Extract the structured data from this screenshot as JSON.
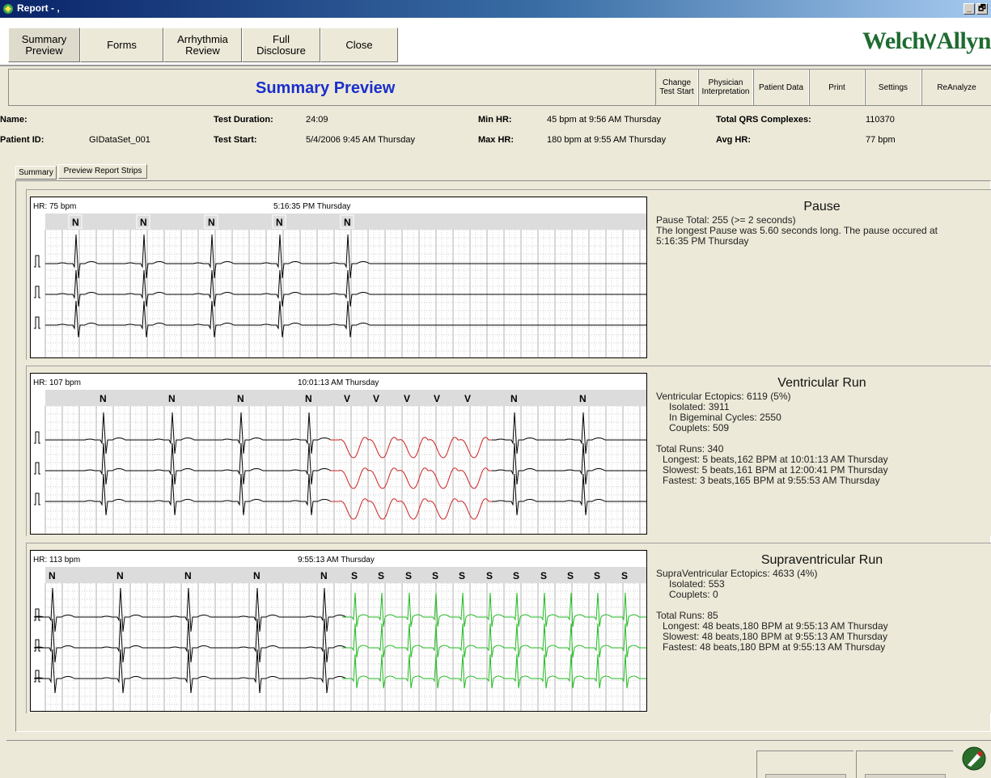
{
  "window": {
    "title": "Report - ,",
    "minimize": "_",
    "restore": "🗗"
  },
  "nav": [
    {
      "id": "summary",
      "label": "Summary\nPreview"
    },
    {
      "id": "forms",
      "label": "Forms"
    },
    {
      "id": "arrhythmia",
      "label": "Arrhythmia\nReview"
    },
    {
      "id": "full",
      "label": "Full\nDisclosure"
    },
    {
      "id": "close",
      "label": "Close"
    }
  ],
  "brand": {
    "left": "Welch",
    "right": "Allyn"
  },
  "header": {
    "title": "Summary Preview",
    "tools": [
      "Change\nTest Start",
      "Physician\nInterpretation",
      "Patient Data",
      "Print",
      "Settings",
      "ReAnalyze"
    ]
  },
  "patient": {
    "name_label": "Name:",
    "name_value": "",
    "id_label": "Patient ID:",
    "id_value": "GIDataSet_001",
    "duration_label": "Test Duration:",
    "duration_value": "24:09",
    "start_label": "Test Start:",
    "start_value": "5/4/2006 9:45 AM Thursday",
    "minhr_label": "Min HR:",
    "minhr_value": "45 bpm at 9:56 AM Thursday",
    "maxhr_label": "Max HR:",
    "maxhr_value": "180 bpm at 9:55 AM Thursday",
    "qrs_label": "Total QRS Complexes:",
    "qrs_value": "110370",
    "avghr_label": "Avg HR:",
    "avghr_value": "77 bpm"
  },
  "tabs": [
    "Summary",
    "Preview Report Strips"
  ],
  "colors": {
    "normal": "#000000",
    "ventricular": "#cc2222",
    "supraventricular": "#22bb22"
  },
  "panels": [
    {
      "hr": "HR: 75 bpm",
      "time": "5:16:35 PM Thursday",
      "beats": [
        "N",
        "N",
        "N",
        "N",
        "N"
      ],
      "title": "Pause",
      "lines": [
        "Pause Total: 255  (>= 2 seconds)",
        "The longest Pause was 5.60 seconds long. The pause occured at",
        "5:16:35 PM Thursday"
      ]
    },
    {
      "hr": "HR: 107 bpm",
      "time": "10:01:13 AM Thursday",
      "beats": [
        "N",
        "N",
        "N",
        "N",
        "V",
        "V",
        "V",
        "V",
        "V",
        "N",
        "N"
      ],
      "title": "Ventricular Run",
      "lines": [
        "Ventricular Ectopics: 6119 (5%)",
        "    Isolated: 3911",
        "    In Bigeminal Cycles: 2550",
        "    Couplets: 509",
        "",
        "Total Runs: 340",
        "   Longest: 5 beats,162 BPM at 10:01:13 AM Thursday",
        "   Slowest: 5 beats,161 BPM at 12:00:41 PM Thursday",
        "   Fastest: 3 beats,165 BPM at 9:55:53 AM Thursday"
      ]
    },
    {
      "hr": "HR: 113 bpm",
      "time": "9:55:13 AM Thursday",
      "beats": [
        "N",
        "N",
        "N",
        "N",
        "N",
        "S",
        "S",
        "S",
        "S",
        "S",
        "S",
        "S",
        "S",
        "S",
        "S",
        "S",
        "S"
      ],
      "title": "Supraventricular Run",
      "lines": [
        "SupraVentricular Ectopics: 4633 (4%)",
        "    Isolated: 553",
        "    Couplets: 0",
        "",
        "Total Runs: 85",
        "   Longest: 48 beats,180 BPM at 9:55:13 AM Thursday",
        "   Slowest: 48 beats,180 BPM at 9:55:13 AM Thursday",
        "   Fastest: 48 beats,180 BPM at 9:55:13 AM Thursday"
      ]
    }
  ]
}
